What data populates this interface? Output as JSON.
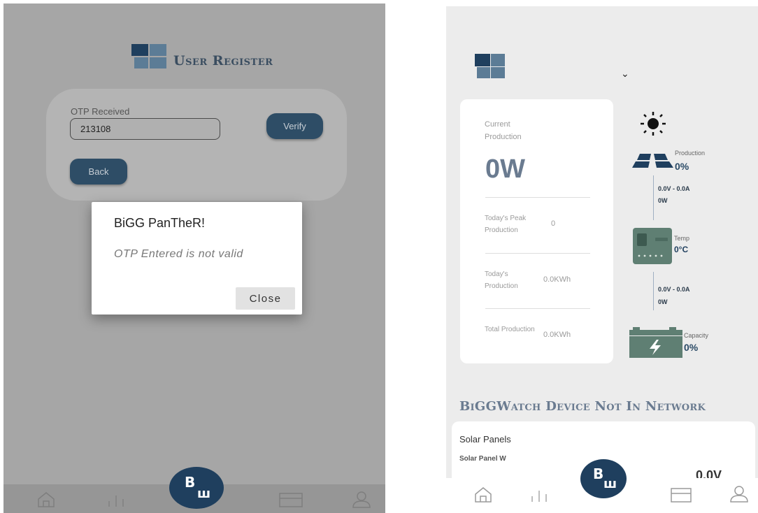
{
  "left": {
    "header": {
      "title": "User Register"
    },
    "otp": {
      "label": "OTP Received",
      "value": "213108",
      "verify_label": "Verify",
      "back_label": "Back"
    },
    "dialog": {
      "title": "BiGG PanTheR!",
      "message": "OTP Entered is not valid",
      "close_label": "Close"
    }
  },
  "right": {
    "dropdown_icon": "chevron-down-icon",
    "production": {
      "current_label": "Current Production",
      "current_value": "0W",
      "rows": [
        {
          "label": "Today's Peak Production",
          "value": "0"
        },
        {
          "label": "Today's Production",
          "value": "0.0KWh"
        },
        {
          "label": "Total Production",
          "value": "0.0KWh"
        }
      ]
    },
    "flow": {
      "production_label": "Production",
      "production_pct": "0%",
      "line1_voltage": "0.0V - 0.0A",
      "line1_power": "0W",
      "temp_label": "Temp",
      "temp_value": "0°C",
      "line2_voltage": "0.0V - 0.0A",
      "line2_power": "0W",
      "capacity_label": "Capacity",
      "capacity_pct": "0%"
    },
    "network_status": "BiGGWatch Device Not In Network",
    "solar": {
      "title": "Solar Panels",
      "subtitle": "Solar Panel W",
      "voltage": "0.0V"
    }
  },
  "colors": {
    "brand_dark": "#1f3f5e",
    "brand_mid": "#5c7c96",
    "button": "#2e4d66",
    "battery": "#5f7f73"
  }
}
